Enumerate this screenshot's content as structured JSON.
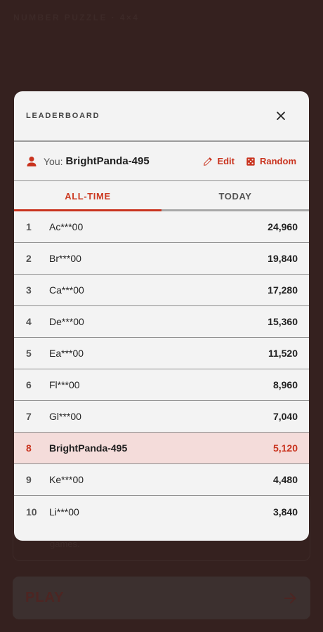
{
  "app": {
    "title": "NUMBER PUZZLE · 4×4",
    "card_text": "games.",
    "play_label": "PLAY"
  },
  "modal": {
    "title": "LEADERBOARD",
    "user_prefix": "You:",
    "user_name": "BrightPanda-495",
    "edit_label": "Edit",
    "random_label": "Random",
    "tabs": [
      {
        "label": "ALL-TIME",
        "active": true
      },
      {
        "label": "TODAY",
        "active": false
      }
    ],
    "entries": [
      {
        "rank": "1",
        "name": "Ac***00",
        "score": "24,960",
        "me": false
      },
      {
        "rank": "2",
        "name": "Br***00",
        "score": "19,840",
        "me": false
      },
      {
        "rank": "3",
        "name": "Ca***00",
        "score": "17,280",
        "me": false
      },
      {
        "rank": "4",
        "name": "De***00",
        "score": "15,360",
        "me": false
      },
      {
        "rank": "5",
        "name": "Ea***00",
        "score": "11,520",
        "me": false
      },
      {
        "rank": "6",
        "name": "Fl***00",
        "score": "8,960",
        "me": false
      },
      {
        "rank": "7",
        "name": "Gl***00",
        "score": "7,040",
        "me": false
      },
      {
        "rank": "8",
        "name": "BrightPanda-495",
        "score": "5,120",
        "me": true
      },
      {
        "rank": "9",
        "name": "Ke***00",
        "score": "4,480",
        "me": false
      },
      {
        "rank": "10",
        "name": "Li***00",
        "score": "3,840",
        "me": false
      }
    ]
  },
  "colors": {
    "accent": "#c9331e",
    "highlight_row": "#f4dcda",
    "backdrop": "#35211f"
  },
  "icons": {
    "close": "close-icon",
    "user": "user-icon",
    "edit": "pencil-icon",
    "random": "dice-icon",
    "play": "arrow-right-icon"
  }
}
